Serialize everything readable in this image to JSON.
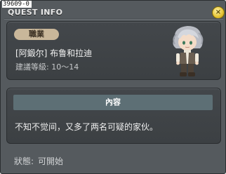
{
  "quest_id": "39609-0",
  "window": {
    "title": "QUEST INFO",
    "close_label": "×"
  },
  "npc": {
    "job_label": "職業",
    "name": "[阿鍛尔] 布鲁和拉迪",
    "level_text": "建議等級: 10～14",
    "portrait_icon": "npc-character-sprite"
  },
  "content": {
    "header": "內容",
    "text": "不知不觉间，又多了两名可疑的家伙。"
  },
  "status": {
    "label": "狀態:",
    "value": "可開始"
  },
  "colors": {
    "panel_bg": "#555a5e",
    "card_bg": "#404447",
    "badge_bg": "#c9b79a",
    "header_bg": "#5d6f75",
    "close_button": "#e4c231"
  }
}
